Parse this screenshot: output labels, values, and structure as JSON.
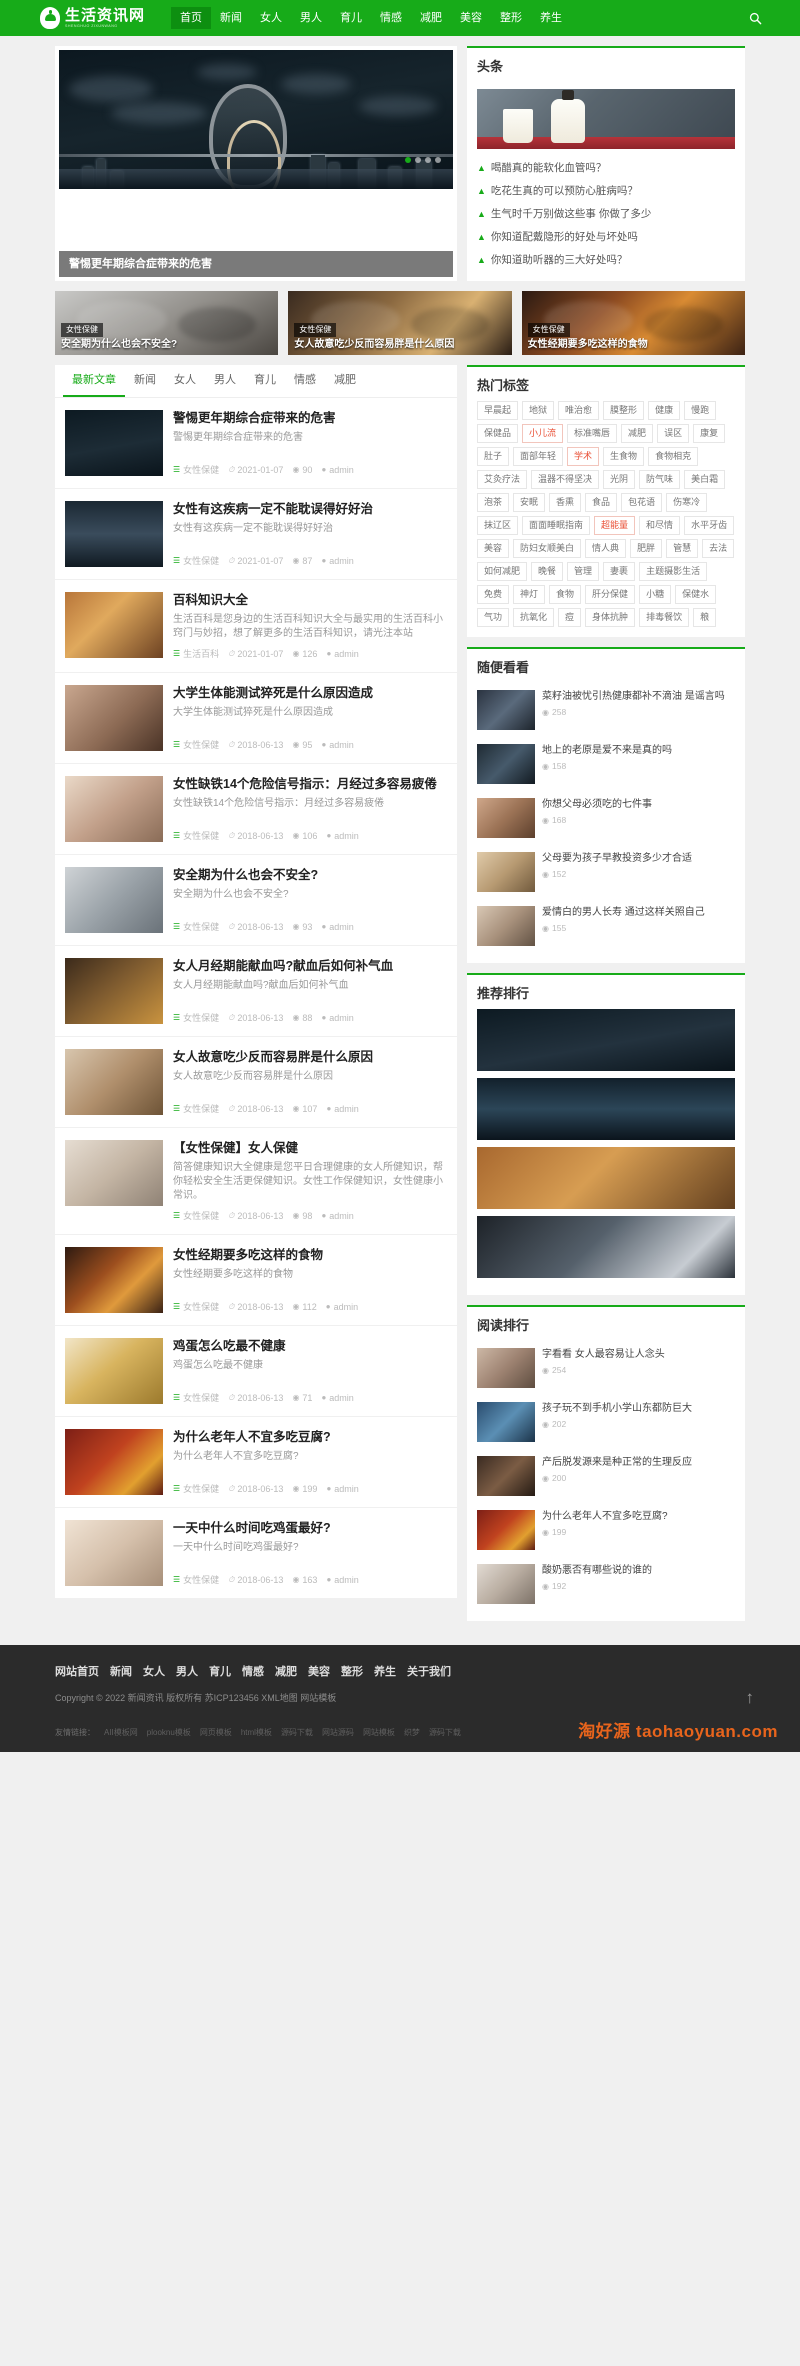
{
  "site": {
    "logo_cn": "生活资讯网",
    "logo_en": "SHENGHUO ZIXUNWANG"
  },
  "nav": {
    "items": [
      {
        "label": "首页",
        "active": true
      },
      {
        "label": "新闻",
        "active": false
      },
      {
        "label": "女人",
        "active": false
      },
      {
        "label": "男人",
        "active": false
      },
      {
        "label": "育儿",
        "active": false
      },
      {
        "label": "情感",
        "active": false
      },
      {
        "label": "减肥",
        "active": false
      },
      {
        "label": "美容",
        "active": false
      },
      {
        "label": "整形",
        "active": false
      },
      {
        "label": "养生",
        "active": false
      }
    ],
    "search_icon": "search-icon"
  },
  "slider": {
    "caption": "警惕更年期综合症带来的危害",
    "overlay_small": "警惕更年期综合症带来的危害"
  },
  "headline": {
    "title": "头条",
    "items": [
      "喝醋真的能软化血管吗？",
      "吃花生真的可以预防心脏病吗？",
      "生气时千万别做这些事 你做了多少",
      "你知道配戴隐形的好处与坏处吗",
      "你知道助听器的三大好处吗？"
    ]
  },
  "cards": [
    {
      "tag": "女性保健",
      "caption": "安全期为什么也会不安全?"
    },
    {
      "tag": "女性保健",
      "caption": "女人故意吃少反而容易胖是什么原因"
    },
    {
      "tag": "女性保健",
      "caption": "女性经期要多吃这样的食物"
    }
  ],
  "tabs": [
    {
      "label": "最新文章",
      "active": true
    },
    {
      "label": "新闻",
      "active": false
    },
    {
      "label": "女人",
      "active": false
    },
    {
      "label": "男人",
      "active": false
    },
    {
      "label": "育儿",
      "active": false
    },
    {
      "label": "情感",
      "active": false
    },
    {
      "label": "减肥",
      "active": false
    }
  ],
  "posts": [
    {
      "title": "警惕更年期综合症带来的危害",
      "desc": "警惕更年期综合症带来的危害",
      "cat": "女性保健",
      "date": "2021-01-07",
      "views": "90",
      "author": "admin",
      "thumb": "bridge"
    },
    {
      "title": "女性有这疾病一定不能耽误得好好治",
      "desc": "女性有这疾病一定不能耽误得好好治",
      "cat": "女性保健",
      "date": "2021-01-07",
      "views": "87",
      "author": "admin",
      "thumb": "city"
    },
    {
      "title": "百科知识大全",
      "desc": "生活百科是您身边的生活百科知识大全与最实用的生活百科小窍门与妙招，想了解更多的生活百科知识，请光注本站",
      "cat": "生活百科",
      "date": "2021-01-07",
      "views": "126",
      "author": "admin",
      "thumb": "food"
    },
    {
      "title": "大学生体能测试猝死是什么原因造成",
      "desc": "大学生体能测试猝死是什么原因造成",
      "cat": "女性保健",
      "date": "2018-06-13",
      "views": "95",
      "author": "admin",
      "thumb": "hands"
    },
    {
      "title": "女性缺铁14个危险信号指示：月经过多容易疲倦",
      "desc": "女性缺铁14个危险信号指示：月经过多容易疲倦",
      "cat": "女性保健",
      "date": "2018-06-13",
      "views": "106",
      "author": "admin",
      "thumb": "girl"
    },
    {
      "title": "安全期为什么也会不安全?",
      "desc": "安全期为什么也会不安全?",
      "cat": "女性保健",
      "date": "2018-06-13",
      "views": "93",
      "author": "admin",
      "thumb": "couple"
    },
    {
      "title": "女人月经期能献血吗?献血后如何补气血",
      "desc": "女人月经期能献血吗?献血后如何补气血",
      "cat": "女性保健",
      "date": "2018-06-13",
      "views": "88",
      "author": "admin",
      "thumb": "tea"
    },
    {
      "title": "女人故意吃少反而容易胖是什么原因",
      "desc": "女人故意吃少反而容易胖是什么原因",
      "cat": "女性保健",
      "date": "2018-06-13",
      "views": "107",
      "author": "admin",
      "thumb": "cafe"
    },
    {
      "title": "【女性保健】女人保健",
      "desc": "简答健康知识大全健康是您平日合理健康的女人所健知识，帮你轻松安全生活更保健知识。女性工作保健知识，女性健康小常识。",
      "cat": "女性保健",
      "date": "2018-06-13",
      "views": "98",
      "author": "admin",
      "thumb": "legs"
    },
    {
      "title": "女性经期要多吃这样的食物",
      "desc": "女性经期要多吃这样的食物",
      "cat": "女性保健",
      "date": "2018-06-13",
      "views": "112",
      "author": "admin",
      "thumb": "autumn"
    },
    {
      "title": "鸡蛋怎么吃最不健康",
      "desc": "鸡蛋怎么吃最不健康",
      "cat": "女性保健",
      "date": "2018-06-13",
      "views": "71",
      "author": "admin",
      "thumb": "egg"
    },
    {
      "title": "为什么老年人不宜多吃豆腐?",
      "desc": "为什么老年人不宜多吃豆腐?",
      "cat": "女性保健",
      "date": "2018-06-13",
      "views": "199",
      "author": "admin",
      "thumb": "tofu"
    },
    {
      "title": "一天中什么时间吃鸡蛋最好?",
      "desc": "一天中什么时间吃鸡蛋最好?",
      "cat": "女性保健",
      "date": "2018-06-13",
      "views": "163",
      "author": "admin",
      "thumb": "eggs"
    }
  ],
  "tagcloud": {
    "title": "热门标签",
    "tags": [
      {
        "label": "早晨起",
        "hot": false
      },
      {
        "label": "地狱",
        "hot": false
      },
      {
        "label": "唯治愈",
        "hot": false
      },
      {
        "label": "膜整形",
        "hot": false
      },
      {
        "label": "健康",
        "hot": false
      },
      {
        "label": "慢跑",
        "hot": false
      },
      {
        "label": "保健品",
        "hot": false
      },
      {
        "label": "小儿流",
        "hot": true
      },
      {
        "label": "标准嘴唇",
        "hot": false
      },
      {
        "label": "减肥",
        "hot": false
      },
      {
        "label": "误区",
        "hot": false
      },
      {
        "label": "康复",
        "hot": false
      },
      {
        "label": "肚子",
        "hot": false
      },
      {
        "label": "面部年轻",
        "hot": false
      },
      {
        "label": "学术",
        "hot": true
      },
      {
        "label": "生食物",
        "hot": false
      },
      {
        "label": "食物相克",
        "hot": false
      },
      {
        "label": "艾灸疗法",
        "hot": false
      },
      {
        "label": "温器不得坚决",
        "hot": false
      },
      {
        "label": "光阴",
        "hot": false
      },
      {
        "label": "防气味",
        "hot": false
      },
      {
        "label": "美白霜",
        "hot": false
      },
      {
        "label": "泡茶",
        "hot": false
      },
      {
        "label": "安眠",
        "hot": false
      },
      {
        "label": "香熏",
        "hot": false
      },
      {
        "label": "食品",
        "hot": false
      },
      {
        "label": "包花语",
        "hot": false
      },
      {
        "label": "伤寒冷",
        "hot": false
      },
      {
        "label": "抹辽区",
        "hot": false
      },
      {
        "label": "面面睡眠指南",
        "hot": false
      },
      {
        "label": "超能量",
        "hot": true
      },
      {
        "label": "和尽情",
        "hot": false
      },
      {
        "label": "水平牙齿",
        "hot": false
      },
      {
        "label": "美容",
        "hot": false
      },
      {
        "label": "防妇女顺美白",
        "hot": false
      },
      {
        "label": "情人典",
        "hot": false
      },
      {
        "label": "肥胖",
        "hot": false
      },
      {
        "label": "管慧",
        "hot": false
      },
      {
        "label": "去法",
        "hot": false
      },
      {
        "label": "如何减肥",
        "hot": false
      },
      {
        "label": "晚餐",
        "hot": false
      },
      {
        "label": "管理",
        "hot": false
      },
      {
        "label": "妻裹",
        "hot": false
      },
      {
        "label": "主题摄影生活",
        "hot": false
      },
      {
        "label": "免费",
        "hot": false
      },
      {
        "label": "神灯",
        "hot": false
      },
      {
        "label": "食物",
        "hot": false
      },
      {
        "label": "肝分保健",
        "hot": false
      },
      {
        "label": "小糖",
        "hot": false
      },
      {
        "label": "保健水",
        "hot": false
      },
      {
        "label": "气功",
        "hot": false
      },
      {
        "label": "抗氧化",
        "hot": false
      },
      {
        "label": "痘",
        "hot": false
      },
      {
        "label": "身体抗肿",
        "hot": false
      },
      {
        "label": "排毒餐饮",
        "hot": false
      },
      {
        "label": "粮",
        "hot": false
      }
    ]
  },
  "lookat": {
    "title": "随便看看",
    "items": [
      {
        "title": "菜籽油被忧引热健康都补不滴油 是谣言吗",
        "views": "258",
        "thumb": "oil"
      },
      {
        "title": "地上的老原是爱不来是真的吗",
        "views": "158",
        "thumb": "ground"
      },
      {
        "title": "你想父母必须吃的七件事",
        "views": "168",
        "thumb": "care"
      },
      {
        "title": "父母要为孩子早教投资多少才合适",
        "views": "152",
        "thumb": "parent"
      },
      {
        "title": "爱情白的男人长寿 通过这样关照自己",
        "views": "155",
        "thumb": "love"
      }
    ]
  },
  "recommend": {
    "title": "推荐排行",
    "items": [
      {
        "thumb": "bridge2"
      },
      {
        "thumb": "cityrain"
      },
      {
        "thumb": "foodtable"
      },
      {
        "thumb": "drive"
      }
    ]
  },
  "reading": {
    "title": "阅读排行",
    "items": [
      {
        "title": "字看看 女人最容易让人念头",
        "views": "254",
        "thumb": "r1"
      },
      {
        "title": "孩子玩不到手机小学山东都防巨大",
        "views": "202",
        "thumb": "r2"
      },
      {
        "title": "产后脱发源来是种正常的生理反应",
        "views": "200",
        "thumb": "r3"
      },
      {
        "title": "为什么老年人不宜多吃豆腐?",
        "views": "199",
        "thumb": "r4"
      },
      {
        "title": "酸奶悪否有哪些说的谁的",
        "views": "192",
        "thumb": "r5"
      }
    ]
  },
  "footer": {
    "nav": [
      "网站首页",
      "新闻",
      "女人",
      "男人",
      "育儿",
      "情感",
      "减肥",
      "美容",
      "整形",
      "养生",
      "关于我们"
    ],
    "copyright": "Copyright © 2022 新闻资讯 版权所有 苏ICP123456 XML地图 网站模板",
    "links_label": "友情链接：",
    "links": [
      "AII模板网",
      "plooknu模板",
      "网页模板",
      "html模板",
      "源码下载",
      "网站源码",
      "网站模板",
      "织梦",
      "源码下载"
    ],
    "totop_icon": "arrow-up-icon",
    "watermark": "淘好源 taohaoyuan.com"
  },
  "meta_icons": {
    "cat": "folder-icon",
    "date": "clock-icon",
    "views": "eye-icon",
    "author": "user-icon"
  }
}
